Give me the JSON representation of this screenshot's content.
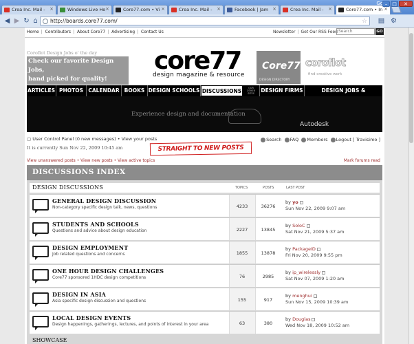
{
  "browser": {
    "tabs": [
      {
        "label": "Crea Inc. Mail -",
        "icon": "gmail-icon",
        "color": "#d93025"
      },
      {
        "label": "Windows Live Ho",
        "icon": "windows-icon",
        "color": "#3a8f3a"
      },
      {
        "label": "Core77.com • Vi",
        "icon": "core77-icon",
        "color": "#222222"
      },
      {
        "label": "Crea Inc. Mail -",
        "icon": "gmail-icon",
        "color": "#d93025"
      },
      {
        "label": "Facebook | Jam",
        "icon": "facebook-icon",
        "color": "#3b5998"
      },
      {
        "label": "Crea Inc. Mail -",
        "icon": "gmail-icon",
        "color": "#d93025"
      },
      {
        "label": "Core77.com • In",
        "icon": "core77-icon",
        "color": "#222222",
        "active": true
      }
    ],
    "google_label": "Google",
    "url": "http://boards.core77.com/"
  },
  "site": {
    "top_links": [
      "Home",
      "Contributors",
      "About Core77",
      "Advertising",
      "Contact Us"
    ],
    "right_links": [
      "Newsletter",
      "Get Our RSS Feed"
    ],
    "search_placeholder": "Search",
    "go_label": "GO",
    "jobs_label": "Coroflot Design Jobs o' the day",
    "jobs_box_line1": "Check our favorite Design Jobs,",
    "jobs_box_line2": "hand picked for quality!",
    "logo": "core77",
    "tagline": "design magazine & resource",
    "ad1_title": "Core77",
    "ad1_sub": "DESIGN DIRECTORY",
    "ad2_title": "coroflot",
    "ad2_sub": "find creative work"
  },
  "nav": [
    {
      "label": "ARTICLES"
    },
    {
      "label": "PHOTOS"
    },
    {
      "label": "CALENDAR"
    },
    {
      "label": "BOOKS"
    },
    {
      "label": "DESIGN SCHOOLS"
    },
    {
      "label": "DISCUSSIONS",
      "active": true
    },
    {
      "label": "OUR OTHER SITES"
    },
    {
      "label": "DESIGN FIRMS"
    },
    {
      "label": "DESIGN JOBS & PORTFOLIOS"
    }
  ],
  "banner": {
    "text": "Experience design and documentation",
    "brand": "Autodesk"
  },
  "user": {
    "ucp_label": "User Control Panel",
    "new_messages": "(0 new messages)",
    "view_posts": "View your posts",
    "current_time": "It is currently Sun Nov 22, 2009 10:45 am",
    "stamp": "STRAIGHT TO NEW POSTS",
    "search_label": "Search",
    "faq_label": "FAQ",
    "members_label": "Members",
    "logout_label": "Logout [ Travisimo ]"
  },
  "sublinks": {
    "unanswered": "View unanswered posts",
    "new": "View new posts",
    "active": "View active topics",
    "mark_read": "Mark forums read"
  },
  "index": {
    "title": "DISCUSSIONS INDEX",
    "section_title": "DESIGN DISCUSSIONS",
    "col_topics": "TOPICS",
    "col_posts": "POSTS",
    "col_last": "LAST POST",
    "forums": [
      {
        "name": "GENERAL DESIGN DISCUSSION",
        "desc": "Non-category specific design talk, news, questions",
        "topics": "4233",
        "posts": "36276",
        "by": "by",
        "author": "yo",
        "date": "Sun Nov 22, 2009 9:07 am"
      },
      {
        "name": "STUDENTS AND SCHOOLS",
        "desc": "Questions and advice about design education",
        "topics": "2227",
        "posts": "13845",
        "by": "by",
        "author": "SoloC",
        "date": "Sat Nov 21, 2009 5:37 am"
      },
      {
        "name": "DESIGN EMPLOYMENT",
        "desc": "Job related questions and concerns",
        "topics": "1855",
        "posts": "13878",
        "by": "by",
        "author": "PackageID",
        "date": "Fri Nov 20, 2009 9:55 pm"
      },
      {
        "name": "ONE HOUR DESIGN CHALLENGES",
        "desc": "Core77 sponsored 1HDC design competitions",
        "topics": "76",
        "posts": "2985",
        "by": "by",
        "author": "ip_wirelessly",
        "date": "Sat Nov 07, 2009 1:20 am"
      },
      {
        "name": "DESIGN IN ASIA",
        "desc": "Asia specific design discussion and questions",
        "topics": "155",
        "posts": "917",
        "by": "by",
        "author": "menghui",
        "date": "Sun Nov 15, 2009 10:39 am"
      },
      {
        "name": "LOCAL DESIGN EVENTS",
        "desc": "Design happenings, gatherings, lectures, and points of interest in your area",
        "topics": "63",
        "posts": "380",
        "by": "by",
        "author": "Douglas",
        "date": "Wed Nov 18, 2009 10:52 am"
      }
    ],
    "next_section": "SHOWCASE"
  }
}
